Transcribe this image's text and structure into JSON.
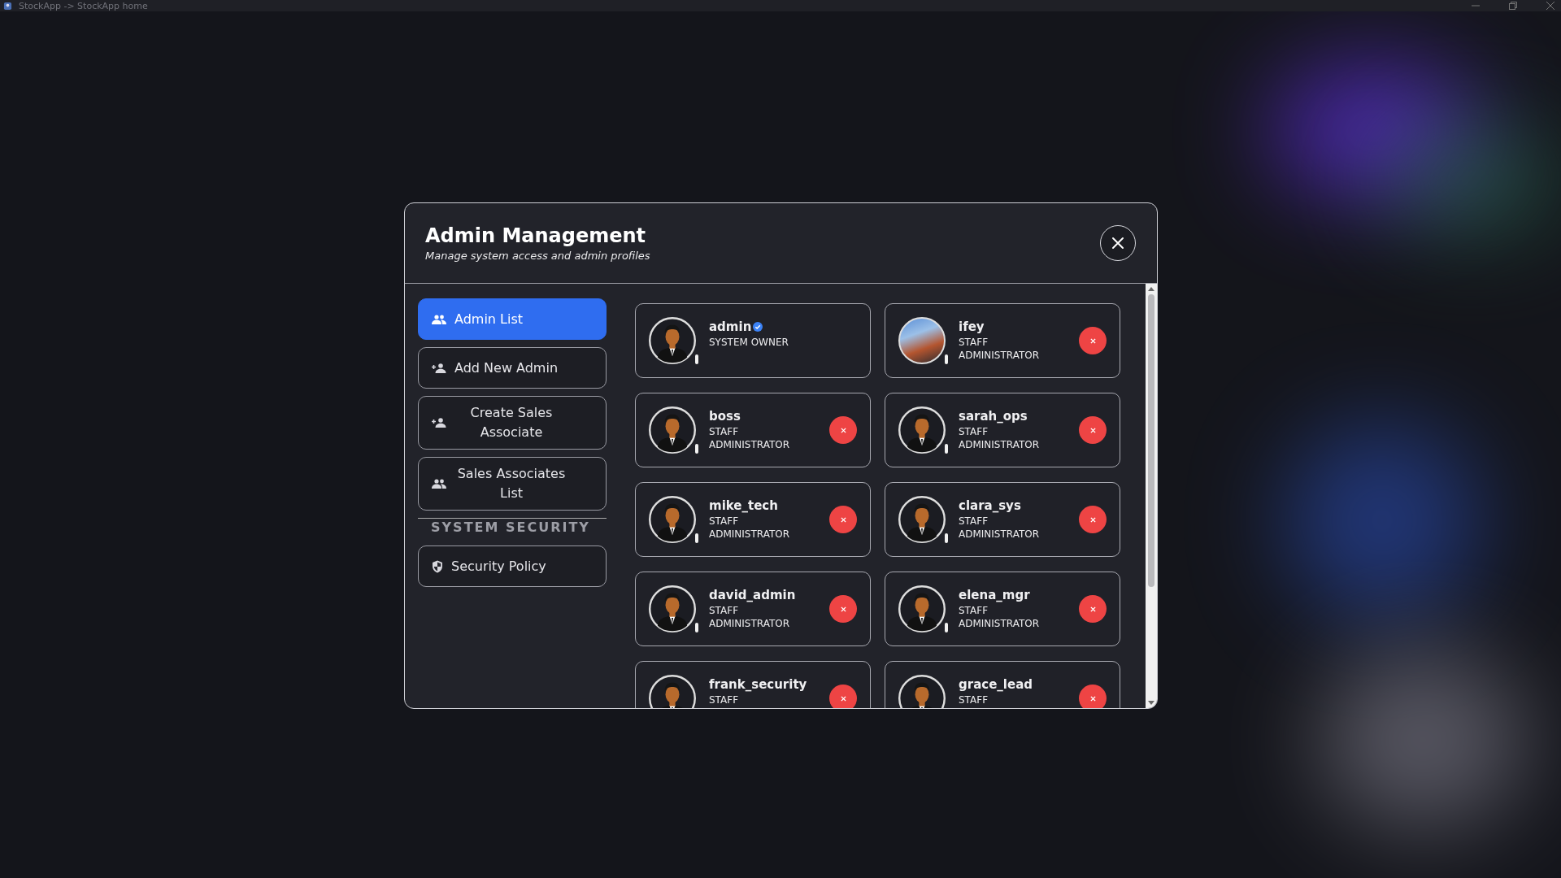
{
  "window": {
    "title": "StockApp -> StockApp home"
  },
  "dialog": {
    "title": "Admin Management",
    "subtitle": "Manage system access and admin profiles"
  },
  "sidebar": {
    "items": [
      {
        "kind": "group",
        "label": "Admin List",
        "selected": true
      },
      {
        "kind": "add-person",
        "label": "Add New Admin",
        "selected": false
      },
      {
        "kind": "add-person",
        "label": "Create Sales Associate",
        "selected": false
      },
      {
        "kind": "group",
        "label": "Sales Associates List",
        "selected": false
      },
      {
        "kind": "heading",
        "label": "SYSTEM SECURITY"
      },
      {
        "kind": "shield",
        "label": "Security Policy",
        "selected": false
      }
    ]
  },
  "admins": [
    {
      "name": "admin",
      "role": "SYSTEM OWNER",
      "verified": true,
      "removable": false,
      "photo": false
    },
    {
      "name": "ifey",
      "role": "STAFF ADMINISTRATOR",
      "verified": false,
      "removable": true,
      "photo": true
    },
    {
      "name": "boss",
      "role": "STAFF ADMINISTRATOR",
      "verified": false,
      "removable": true,
      "photo": false
    },
    {
      "name": "sarah_ops",
      "role": "STAFF ADMINISTRATOR",
      "verified": false,
      "removable": true,
      "photo": false
    },
    {
      "name": "mike_tech",
      "role": "STAFF ADMINISTRATOR",
      "verified": false,
      "removable": true,
      "photo": false
    },
    {
      "name": "clara_sys",
      "role": "STAFF ADMINISTRATOR",
      "verified": false,
      "removable": true,
      "photo": false
    },
    {
      "name": "david_admin",
      "role": "STAFF ADMINISTRATOR",
      "verified": false,
      "removable": true,
      "photo": false
    },
    {
      "name": "elena_mgr",
      "role": "STAFF ADMINISTRATOR",
      "verified": false,
      "removable": true,
      "photo": false
    },
    {
      "name": "frank_security",
      "role": "STAFF",
      "verified": false,
      "removable": true,
      "photo": false
    },
    {
      "name": "grace_lead",
      "role": "STAFF",
      "verified": false,
      "removable": true,
      "photo": false
    }
  ]
}
